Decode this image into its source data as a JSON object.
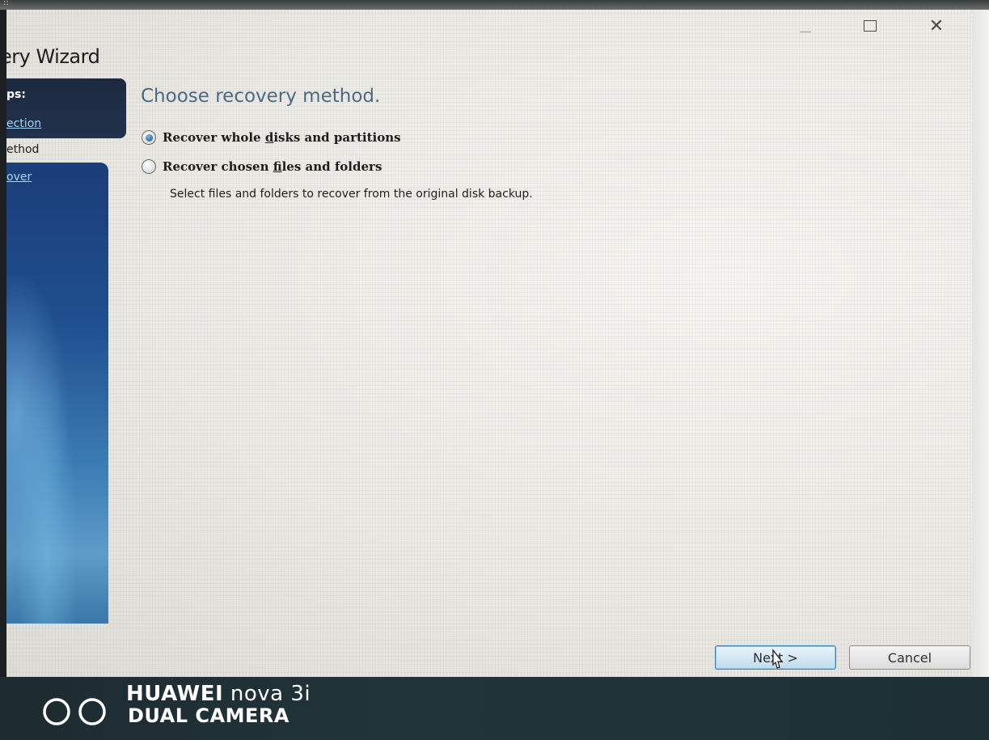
{
  "window": {
    "title": "ery Wizard",
    "top_fragment": "::",
    "controls": [
      "minimize",
      "maximize",
      "close"
    ],
    "close_glyph": "✕"
  },
  "sidebar": {
    "steps_heading": "ps:",
    "items": [
      {
        "label": "ection",
        "state": "link"
      },
      {
        "label": "ethod",
        "state": "current"
      },
      {
        "label": "over",
        "state": "link"
      }
    ]
  },
  "main": {
    "heading": "Choose recovery method.",
    "options": [
      {
        "pre": "Recover whole ",
        "accel": "d",
        "post": "isks and partitions",
        "selected": true
      },
      {
        "pre": "Recover chosen ",
        "accel": "f",
        "post": "iles and folders",
        "selected": false
      }
    ],
    "option_description": "Select files and folders to recover from the original disk backup."
  },
  "footer": {
    "next_label": "Next >",
    "cancel_label": "Cancel"
  },
  "watermark": {
    "brand": "HUAWEI",
    "model": "nova 3i",
    "sub": "DUAL CAMERA"
  },
  "colors": {
    "sidebar_dark": "#1c2940",
    "link": "#9fd2ff",
    "heading": "#4a6a86",
    "next_border": "#3c7fb1"
  },
  "icons": [
    "minimize-icon",
    "maximize-icon",
    "close-icon",
    "radio-selected-icon",
    "radio-unselected-icon",
    "mouse-cursor-icon",
    "camera-lens-icon"
  ]
}
